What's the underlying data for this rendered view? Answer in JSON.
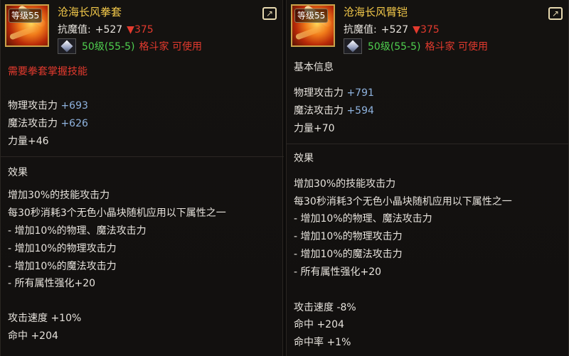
{
  "left": {
    "level_badge": "等级55",
    "name": "沧海长风拳套",
    "resist_label": "抗魔值:",
    "resist_value": "+527",
    "resist_down": "▼375",
    "req_level": "50级(55-5)",
    "req_class": "格斗家 可使用",
    "note": "需要拳套掌握技能",
    "stats": [
      {
        "label": "物理攻击力",
        "value": "+693"
      },
      {
        "label": "魔法攻击力",
        "value": "+626"
      },
      {
        "label": "力量+46",
        "value": ""
      }
    ],
    "effect_header": "效果",
    "effects": [
      "增加30%的技能攻击力",
      "每30秒消耗3个无色小晶块随机应用以下属性之一",
      "- 增加10%的物理、魔法攻击力",
      "- 增加10%的物理攻击力",
      "- 增加10%的魔法攻击力",
      "- 所有属性强化+20"
    ],
    "extra": [
      "攻击速度 +10%",
      "命中 +204"
    ]
  },
  "right": {
    "level_badge": "等级55",
    "name": "沧海长风臂铠",
    "resist_label": "抗魔值:",
    "resist_value": "+527",
    "resist_down": "▼375",
    "req_level": "50级(55-5)",
    "req_class": "格斗家 可使用",
    "basic_header": "基本信息",
    "stats": [
      {
        "label": "物理攻击力",
        "value": "+791"
      },
      {
        "label": "魔法攻击力",
        "value": "+594"
      },
      {
        "label": "力量+70",
        "value": ""
      }
    ],
    "effect_header": "效果",
    "effects": [
      "增加30%的技能攻击力",
      "每30秒消耗3个无色小晶块随机应用以下属性之一",
      "- 增加10%的物理、魔法攻击力",
      "- 增加10%的物理攻击力",
      "- 增加10%的魔法攻击力",
      "- 所有属性强化+20"
    ],
    "extra": [
      "攻击速度 -8%",
      "命中 +204",
      "命中率 +1%"
    ]
  },
  "icons": {
    "item_icon": "gauntlet-fire-icon",
    "share_icon": "share-icon",
    "gem_icon": "diamond-gem-icon"
  },
  "colors": {
    "title": "#f2c84a",
    "stat_blue": "#8fb3df",
    "req_green": "#4fd04f",
    "warn_red": "#e33a2e"
  }
}
